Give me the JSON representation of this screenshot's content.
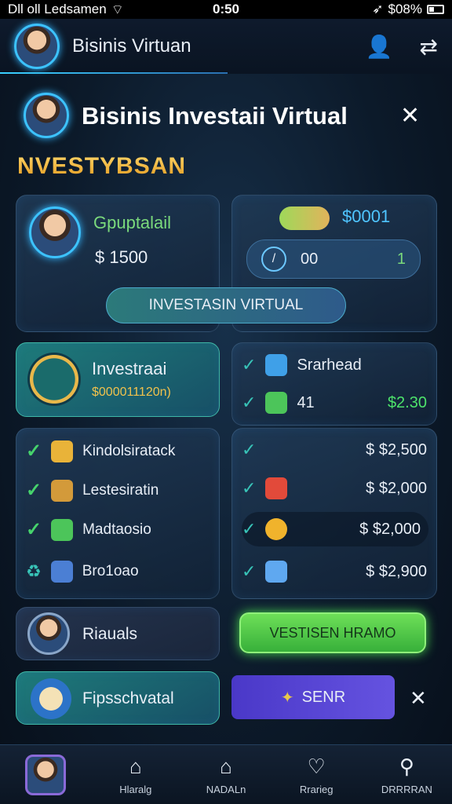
{
  "status": {
    "carrier": "Dll oll Ledsamen",
    "time": "0:50",
    "right_text": "$08%"
  },
  "appbar": {
    "title": "Bisinis Virtuan",
    "user_icon": "user-icon",
    "share_icon": "share-icon"
  },
  "header": {
    "title": "Bisinis Investaii Virtual",
    "close_icon": "close-icon"
  },
  "section_label": "NVESTYBSAN",
  "card_profile": {
    "name": "Gpuptalail",
    "amount": "$ 1500"
  },
  "card_balance": {
    "amount": "$0001",
    "left_value": "00",
    "right_value": "1"
  },
  "virtual_button": "INVESTASIN VIRTUAL",
  "invest_card": {
    "title": "Investraai",
    "value": "$000011120n)"
  },
  "right_list_top": [
    {
      "label": "Srarhead",
      "value": ""
    },
    {
      "label": "41",
      "value": "$2.30"
    }
  ],
  "left_list": [
    {
      "label": "Kindolsiratack"
    },
    {
      "label": "Lestesiratin"
    },
    {
      "label": "Madtaosio"
    },
    {
      "label": "Bro1oao"
    }
  ],
  "right_list": [
    {
      "value": "$ $2,500"
    },
    {
      "value": "$ $2,000"
    },
    {
      "value": "$ $2,000"
    },
    {
      "value": "$ $2,900"
    }
  ],
  "riauals": {
    "label": "Riauals"
  },
  "green_button": "VESTISEN HRAMO",
  "fipsch": {
    "label": "Fipsschvatal"
  },
  "senr_button": "SENR",
  "dismiss_icon": "close-icon",
  "nav": [
    {
      "label": "",
      "icon": "profile-icon"
    },
    {
      "label": "Hlaralg",
      "icon": "home-icon"
    },
    {
      "label": "NADALn",
      "icon": "shop-icon"
    },
    {
      "label": "Rrarieg",
      "icon": "heart-icon"
    },
    {
      "label": "DRRRRAN",
      "icon": "user-icon"
    }
  ],
  "colors": {
    "accent": "#39d0ff",
    "green": "#4de36b",
    "gold": "#f1c24c",
    "purple": "#5a3fd6"
  }
}
